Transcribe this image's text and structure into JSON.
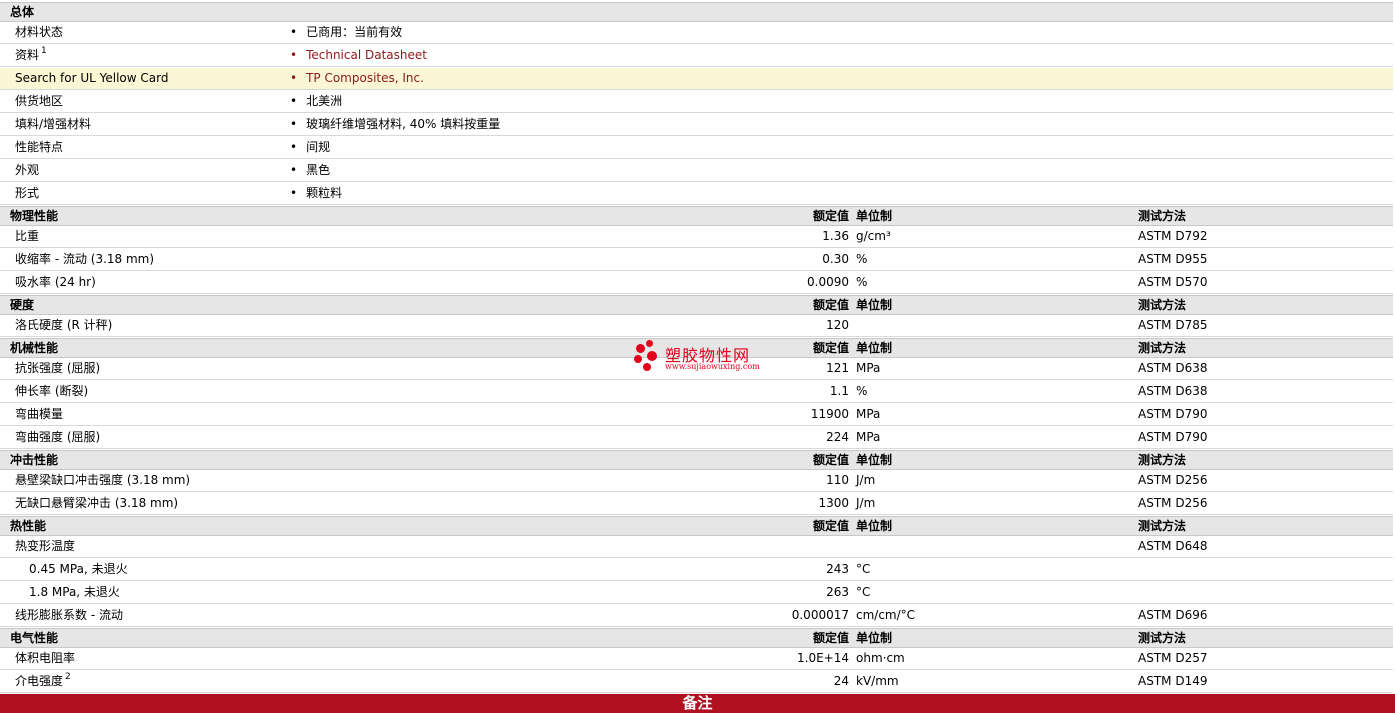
{
  "sections": [
    {
      "title": "总体",
      "kind": "general",
      "rows": [
        {
          "label": "材料状态",
          "sup": "",
          "value": "已商用：当前有效",
          "link": false,
          "highlight": false
        },
        {
          "label": "资料",
          "sup": "1",
          "value": "Technical Datasheet",
          "link": true,
          "highlight": false
        },
        {
          "label": "Search for UL Yellow Card",
          "sup": "",
          "value": "TP Composites, Inc.",
          "link": true,
          "highlight": true
        },
        {
          "label": "供货地区",
          "sup": "",
          "value": "北美洲",
          "link": false,
          "highlight": false
        },
        {
          "label": "填料/增强材料",
          "sup": "",
          "value": "玻璃纤维增强材料, 40% 填料按重量",
          "link": false,
          "highlight": false
        },
        {
          "label": "性能特点",
          "sup": "",
          "value": "间规",
          "link": false,
          "highlight": false
        },
        {
          "label": "外观",
          "sup": "",
          "value": "黑色",
          "link": false,
          "highlight": false
        },
        {
          "label": "形式",
          "sup": "",
          "value": "颗粒料",
          "link": false,
          "highlight": false
        }
      ]
    },
    {
      "title": "物理性能",
      "kind": "props",
      "rows": [
        {
          "label": "比重",
          "nominal": "1.36",
          "unit": "g/cm³",
          "test": "ASTM D792"
        },
        {
          "label": "收缩率  - 流动  (3.18 mm)",
          "nominal": "0.30",
          "unit": "%",
          "test": "ASTM D955"
        },
        {
          "label": "吸水率  (24 hr)",
          "nominal": "0.0090",
          "unit": "%",
          "test": "ASTM D570"
        }
      ]
    },
    {
      "title": "硬度",
      "kind": "props",
      "rows": [
        {
          "label": "洛氏硬度  (R 计秤)",
          "nominal": "120",
          "unit": "",
          "test": "ASTM D785"
        }
      ]
    },
    {
      "title": "机械性能",
      "kind": "props",
      "rows": [
        {
          "label": "抗张强度  (屈服)",
          "nominal": "121",
          "unit": "MPa",
          "test": "ASTM D638"
        },
        {
          "label": "伸长率  (断裂)",
          "nominal": "1.1",
          "unit": "%",
          "test": "ASTM D638"
        },
        {
          "label": "弯曲模量",
          "nominal": "11900",
          "unit": "MPa",
          "test": "ASTM D790"
        },
        {
          "label": "弯曲强度  (屈服)",
          "nominal": "224",
          "unit": "MPa",
          "test": "ASTM D790"
        }
      ]
    },
    {
      "title": "冲击性能",
      "kind": "props",
      "rows": [
        {
          "label": "悬壁梁缺口冲击强度  (3.18 mm)",
          "nominal": "110",
          "unit": "J/m",
          "test": "ASTM D256"
        },
        {
          "label": "无缺口悬臂梁冲击  (3.18 mm)",
          "nominal": "1300",
          "unit": "J/m",
          "test": "ASTM D256"
        }
      ]
    },
    {
      "title": "热性能",
      "kind": "props",
      "rows": [
        {
          "label": "热变形温度",
          "nominal": "",
          "unit": "",
          "test": "ASTM D648"
        },
        {
          "label": "0.45 MPa, 未退火",
          "sub": true,
          "nominal": "243",
          "unit": "°C",
          "test": ""
        },
        {
          "label": "1.8 MPa, 未退火",
          "sub": true,
          "nominal": "263",
          "unit": "°C",
          "test": ""
        },
        {
          "label": "线形膨胀系数  - 流动",
          "nominal": "0.000017",
          "unit": "cm/cm/°C",
          "test": "ASTM D696"
        }
      ]
    },
    {
      "title": "电气性能",
      "kind": "props",
      "rows": [
        {
          "label": "体积电阻率",
          "nominal": "1.0E+14",
          "unit": "ohm·cm",
          "test": "ASTM D257"
        },
        {
          "label": "介电强度",
          "sup": "2",
          "nominal": "24",
          "unit": "kV/mm",
          "test": "ASTM D149"
        }
      ]
    }
  ],
  "columns": {
    "nominal": "额定值",
    "unit": "单位制",
    "test": "测试方法"
  },
  "notes_bar": "备注",
  "watermark": {
    "name": "塑胶物性网",
    "url": "www.sujiaowuxing.com"
  },
  "colors": {
    "header_bg": "#e6e6e6",
    "highlight_bg": "#fbf7d4",
    "link": "#8b1a1a",
    "notes_bg": "#b01020",
    "watermark": "#e2001a"
  }
}
